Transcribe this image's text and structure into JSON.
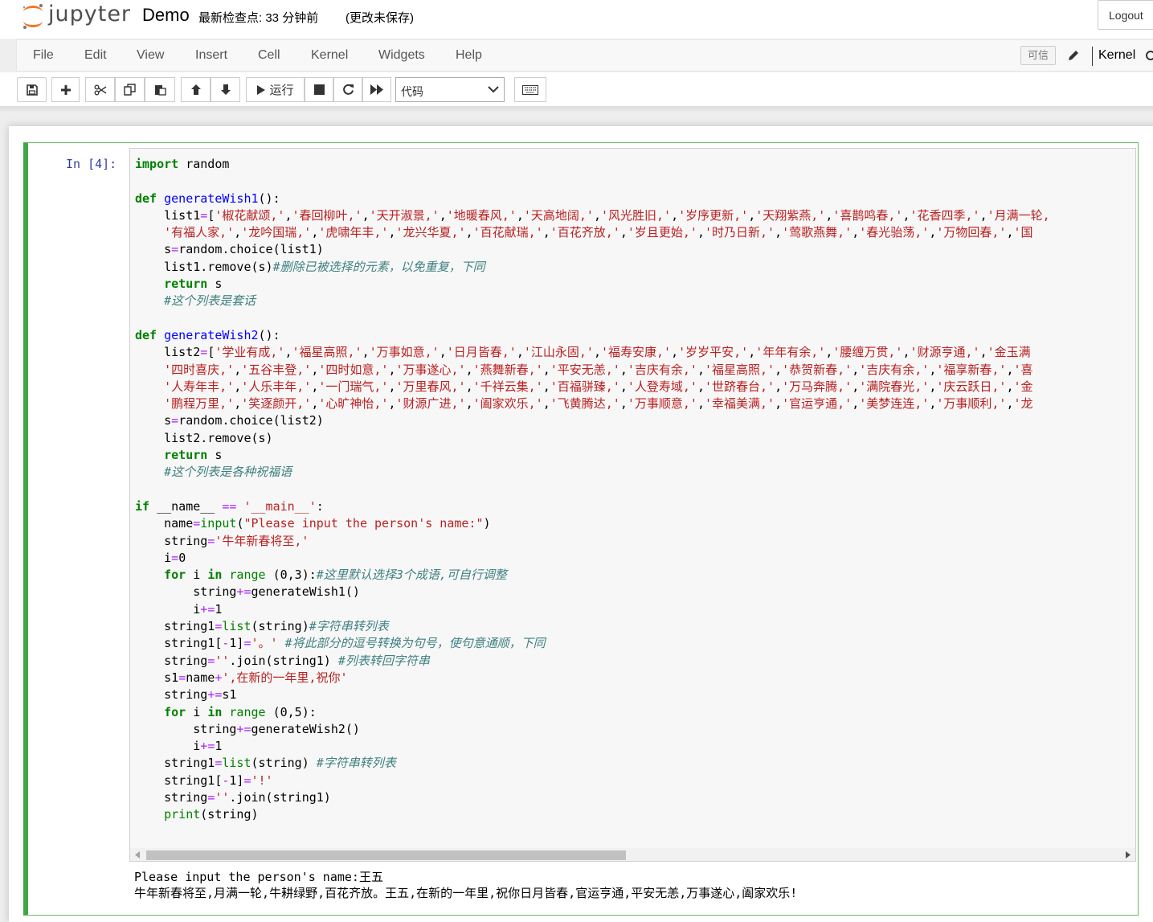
{
  "header": {
    "logo_text": "jupyter",
    "notebook_name": "Demo",
    "checkpoint": "最新检查点: 33 分钟前",
    "autosave": "(更改未保存)",
    "logout_label": "Logout"
  },
  "menubar": {
    "items": [
      "File",
      "Edit",
      "View",
      "Insert",
      "Cell",
      "Kernel",
      "Widgets",
      "Help"
    ],
    "trusted_label": "可信",
    "kernel_label": "Kernel"
  },
  "toolbar": {
    "run_label": "运行",
    "cell_type": "代码"
  },
  "cell": {
    "prompt": "In  [4]:",
    "code_lines": [
      "import random",
      "",
      "def generateWish1():",
      "    list1=['椒花献颂,','春回柳叶,','天开淑景,','地暖春风,','天高地阔,','风光胜旧,','岁序更新,','天翔紫燕,','喜鹊鸣春,','花香四季,','月满一轮,",
      "    '有福人家,','龙吟国瑞,','虎啸年丰,','龙兴华夏,','百花献瑞,','百花齐放,','岁且更始,','时乃日新,','莺歌燕舞,','春光骀荡,','万物回春,','国",
      "    s=random.choice(list1)",
      "    list1.remove(s)#删除已被选择的元素，以免重复，下同",
      "    return s",
      "    #这个列表是套话",
      "",
      "def generateWish2():",
      "    list2=['学业有成,','福星高照,','万事如意,','日月皆春,','江山永固,','福寿安康,','岁岁平安,','年年有余,','腰缠万贯,','财源亨通,','金玉满",
      "    '四时喜庆,','五谷丰登,','四时如意,','万事遂心,','燕舞新春,','平安无恙,','吉庆有余,','福星高照,','恭贺新春,','吉庆有余,','福享新春,','喜",
      "    '人寿年丰,','人乐丰年,','一门瑞气,','万里春风,','千祥云集,','百福骈臻,','人登寿域,','世跻春台,','万马奔腾,','满院春光,','庆云跃日,','金",
      "    '鹏程万里,','笑逐颜开,','心旷神怡,','财源广进,','阖家欢乐,','飞黄腾达,','万事顺意,','幸福美满,','官运亨通,','美梦连连,','万事顺利,','龙",
      "    s=random.choice(list2)",
      "    list2.remove(s)",
      "    return s",
      "    #这个列表是各种祝福语",
      "",
      "if __name__ == '__main__':",
      "    name=input(\"Please input the person's name:\")",
      "    string='牛年新春将至,'",
      "    i=0",
      "    for i in range (0,3):#这里默认选择3个成语,可自行调整",
      "        string+=generateWish1()",
      "        i+=1",
      "    string1=list(string)#字符串转列表",
      "    string1[-1]='。' #将此部分的逗号转换为句号，使句意通顺，下同",
      "    string=''.join(string1) #列表转回字符串",
      "    s1=name+',在新的一年里,祝你'",
      "    string+=s1",
      "    for i in range (0,5):",
      "        string+=generateWish2()",
      "        i+=1",
      "    string1=list(string) #字符串转列表",
      "    string1[-1]='!'",
      "    string=''.join(string1)",
      "    print(string)"
    ],
    "output_lines": [
      "Please input the person's name:王五",
      "牛年新春将至,月满一轮,牛耕绿野,百花齐放。王五,在新的一年里,祝你日月皆春,官运亨通,平安无恙,万事遂心,阖家欢乐!"
    ]
  }
}
